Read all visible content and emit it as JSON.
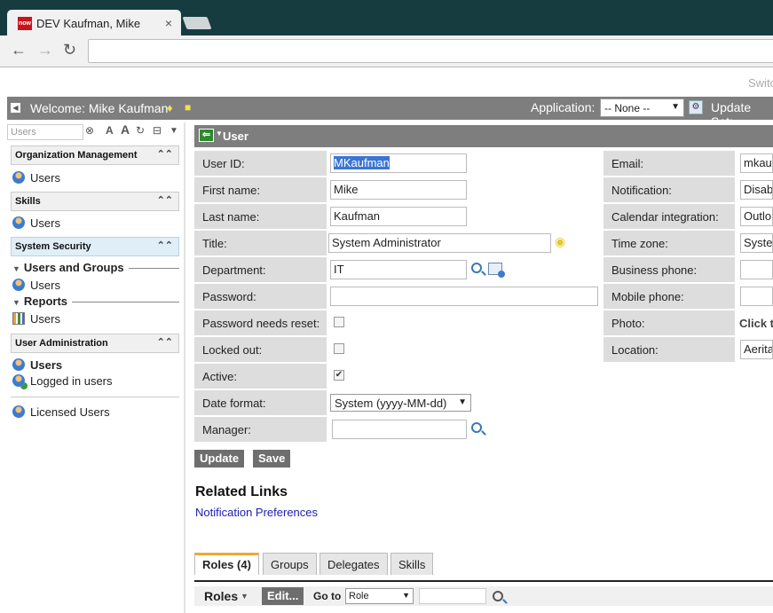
{
  "browser": {
    "tab_favicon_text": "now",
    "tab_title": "DEV Kaufman, Mike",
    "tab_close": "×",
    "nav_back": "←",
    "nav_forward": "→",
    "nav_reload": "↻",
    "address": ""
  },
  "header": {
    "switch_text": "Switc",
    "welcome": "Welcome: Mike Kaufman",
    "application_label": "Application:",
    "application_value": "-- None --",
    "update_set_label": "Update Set:"
  },
  "leftnav": {
    "filter_placeholder": "Users",
    "sections": [
      {
        "title": "Organization Management",
        "items": [
          "Users"
        ]
      },
      {
        "title": "Skills",
        "items": [
          "Users"
        ]
      },
      {
        "title": "System Security",
        "subsections": [
          {
            "title": "Users and Groups",
            "items": [
              "Users"
            ]
          },
          {
            "title": "Reports",
            "items": [
              "Users"
            ]
          }
        ]
      },
      {
        "title": "User Administration",
        "items": [
          "Users",
          "Logged in users"
        ]
      }
    ],
    "extra_item": "Licensed Users"
  },
  "form": {
    "title": "User",
    "left_fields": [
      {
        "label": "User ID:",
        "value": "MKaufman"
      },
      {
        "label": "First name:",
        "value": "Mike"
      },
      {
        "label": "Last name:",
        "value": "Kaufman"
      },
      {
        "label": "Title:",
        "value": "System Administrator"
      },
      {
        "label": "Department:",
        "value": "IT"
      },
      {
        "label": "Password:",
        "value": ""
      },
      {
        "label": "Password needs reset:",
        "value": ""
      },
      {
        "label": "Locked out:",
        "value": ""
      },
      {
        "label": "Active:",
        "value": "✔"
      },
      {
        "label": "Date format:",
        "value": "System (yyyy-MM-dd)"
      },
      {
        "label": "Manager:",
        "value": ""
      }
    ],
    "right_fields": [
      {
        "label": "Email:",
        "value": "mkauf"
      },
      {
        "label": "Notification:",
        "value": "Disab"
      },
      {
        "label": "Calendar integration:",
        "value": "Outlo"
      },
      {
        "label": "Time zone:",
        "value": "Syste"
      },
      {
        "label": "Business phone:",
        "value": ""
      },
      {
        "label": "Mobile phone:",
        "value": ""
      },
      {
        "label": "Photo:",
        "value": "Click t"
      },
      {
        "label": "Location:",
        "value": "Aeritac"
      }
    ],
    "buttons": {
      "update": "Update",
      "save": "Save"
    }
  },
  "related": {
    "title": "Related Links",
    "links": [
      "Notification Preferences"
    ]
  },
  "tabs": [
    "Roles (4)",
    "Groups",
    "Delegates",
    "Skills"
  ],
  "roles_bar": {
    "label": "Roles",
    "edit": "Edit...",
    "goto": "Go to",
    "goto_value": "Role"
  }
}
